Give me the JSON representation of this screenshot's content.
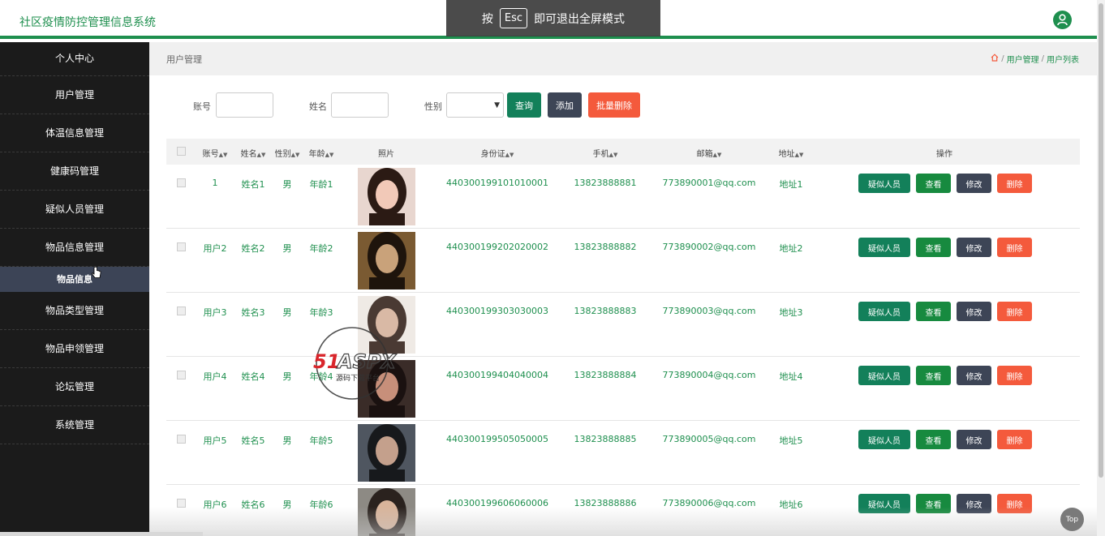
{
  "app": {
    "title": "社区疫情防控管理信息系统"
  },
  "fullscreen_toast": {
    "prefix": "按",
    "key": "Esc",
    "suffix": "即可退出全屏模式"
  },
  "sidebar": {
    "items": [
      {
        "label": "个人中心"
      },
      {
        "label": "用户管理"
      },
      {
        "label": "体温信息管理"
      },
      {
        "label": "健康码管理"
      },
      {
        "label": "疑似人员管理"
      },
      {
        "label": "物品信息管理"
      },
      {
        "label": "物品信息"
      },
      {
        "label": "物品类型管理"
      },
      {
        "label": "物品申领管理"
      },
      {
        "label": "论坛管理"
      },
      {
        "label": "系统管理"
      }
    ]
  },
  "page": {
    "title": "用户管理",
    "breadcrumb": [
      "用户管理",
      "用户列表"
    ]
  },
  "search": {
    "account_label": "账号",
    "name_label": "姓名",
    "gender_label": "性别",
    "query_label": "查询",
    "add_label": "添加",
    "batch_delete_label": "批量删除"
  },
  "table": {
    "columns": [
      "账号",
      "姓名",
      "性别",
      "年龄",
      "照片",
      "身份证",
      "手机",
      "邮箱",
      "地址",
      "操作"
    ],
    "actions": {
      "suspect": "疑似人员",
      "view": "查看",
      "edit": "修改",
      "delete": "删除"
    },
    "rows": [
      {
        "account": "1",
        "name": "姓名1",
        "gender": "男",
        "age": "年龄1",
        "id_card": "440300199101010001",
        "phone": "13823888881",
        "email": "773890001@qq.com",
        "address": "地址1"
      },
      {
        "account": "用户2",
        "name": "姓名2",
        "gender": "男",
        "age": "年龄2",
        "id_card": "440300199202020002",
        "phone": "13823888882",
        "email": "773890002@qq.com",
        "address": "地址2"
      },
      {
        "account": "用户3",
        "name": "姓名3",
        "gender": "男",
        "age": "年龄3",
        "id_card": "440300199303030003",
        "phone": "13823888883",
        "email": "773890003@qq.com",
        "address": "地址3"
      },
      {
        "account": "用户4",
        "name": "姓名4",
        "gender": "男",
        "age": "年龄4",
        "id_card": "440300199404040004",
        "phone": "13823888884",
        "email": "773890004@qq.com",
        "address": "地址4"
      },
      {
        "account": "用户5",
        "name": "姓名5",
        "gender": "男",
        "age": "年龄5",
        "id_card": "440300199505050005",
        "phone": "13823888885",
        "email": "773890005@qq.com",
        "address": "地址5"
      },
      {
        "account": "用户6",
        "name": "姓名6",
        "gender": "男",
        "age": "年龄6",
        "id_card": "440300199606060006",
        "phone": "13823888886",
        "email": "773890006@qq.com",
        "address": "地址6"
      }
    ]
  },
  "watermark": {
    "brand": "51ASPX",
    "sub": "源码下载平台"
  },
  "top_button": {
    "label": "Top"
  },
  "colors": {
    "brand_green": "#1e8f4e",
    "sidebar_bg": "#1b1b1b",
    "danger": "#f45a3c",
    "dark_button": "#3d4556"
  }
}
